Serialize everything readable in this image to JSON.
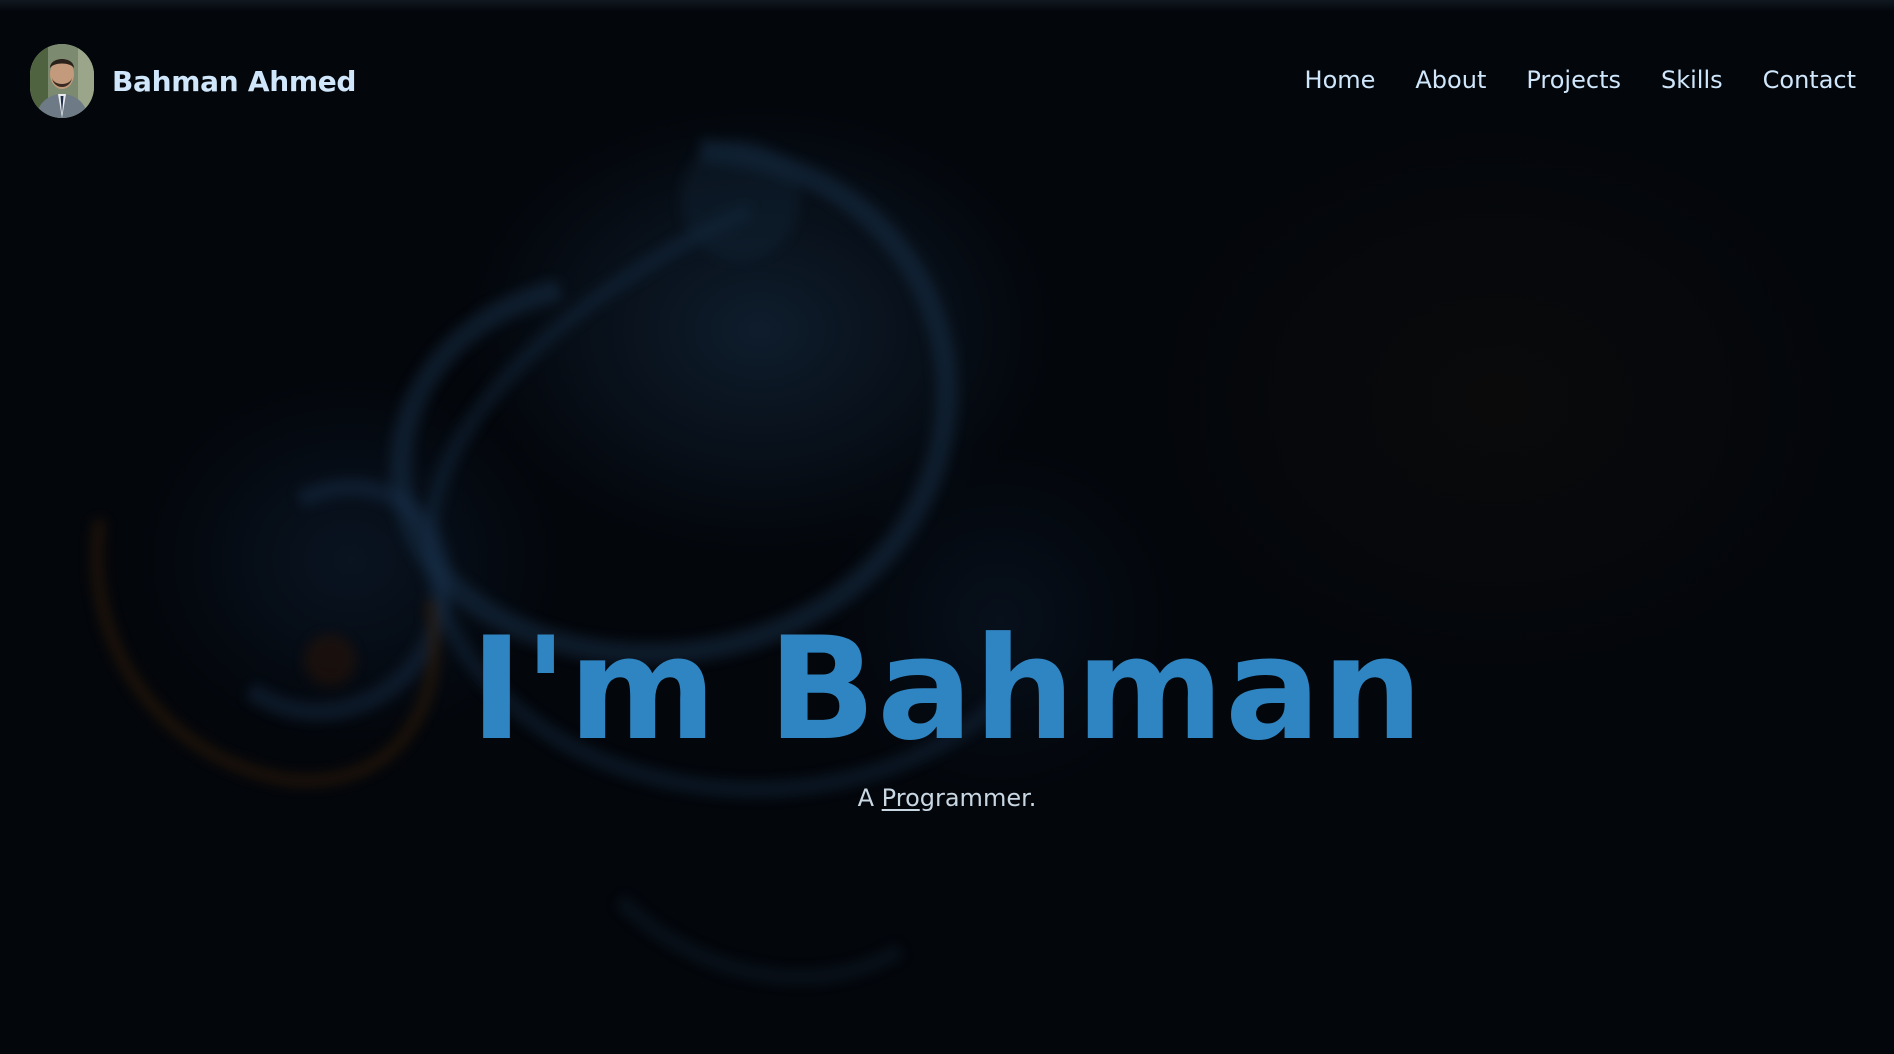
{
  "header": {
    "brand_name": "Bahman Ahmed"
  },
  "nav": {
    "items": [
      {
        "label": "Home"
      },
      {
        "label": "About"
      },
      {
        "label": "Projects"
      },
      {
        "label": "Skills"
      },
      {
        "label": "Contact"
      }
    ]
  },
  "hero": {
    "title": "I'm Bahman",
    "subtitle_prefix": "A ",
    "subtitle_typed": "Pro",
    "subtitle_rest": "grammer."
  },
  "colors": {
    "background": "#03060b",
    "accent": "#2f85c2",
    "nav_text": "#cfe6fb",
    "subtitle_text": "#c9d7e3"
  }
}
